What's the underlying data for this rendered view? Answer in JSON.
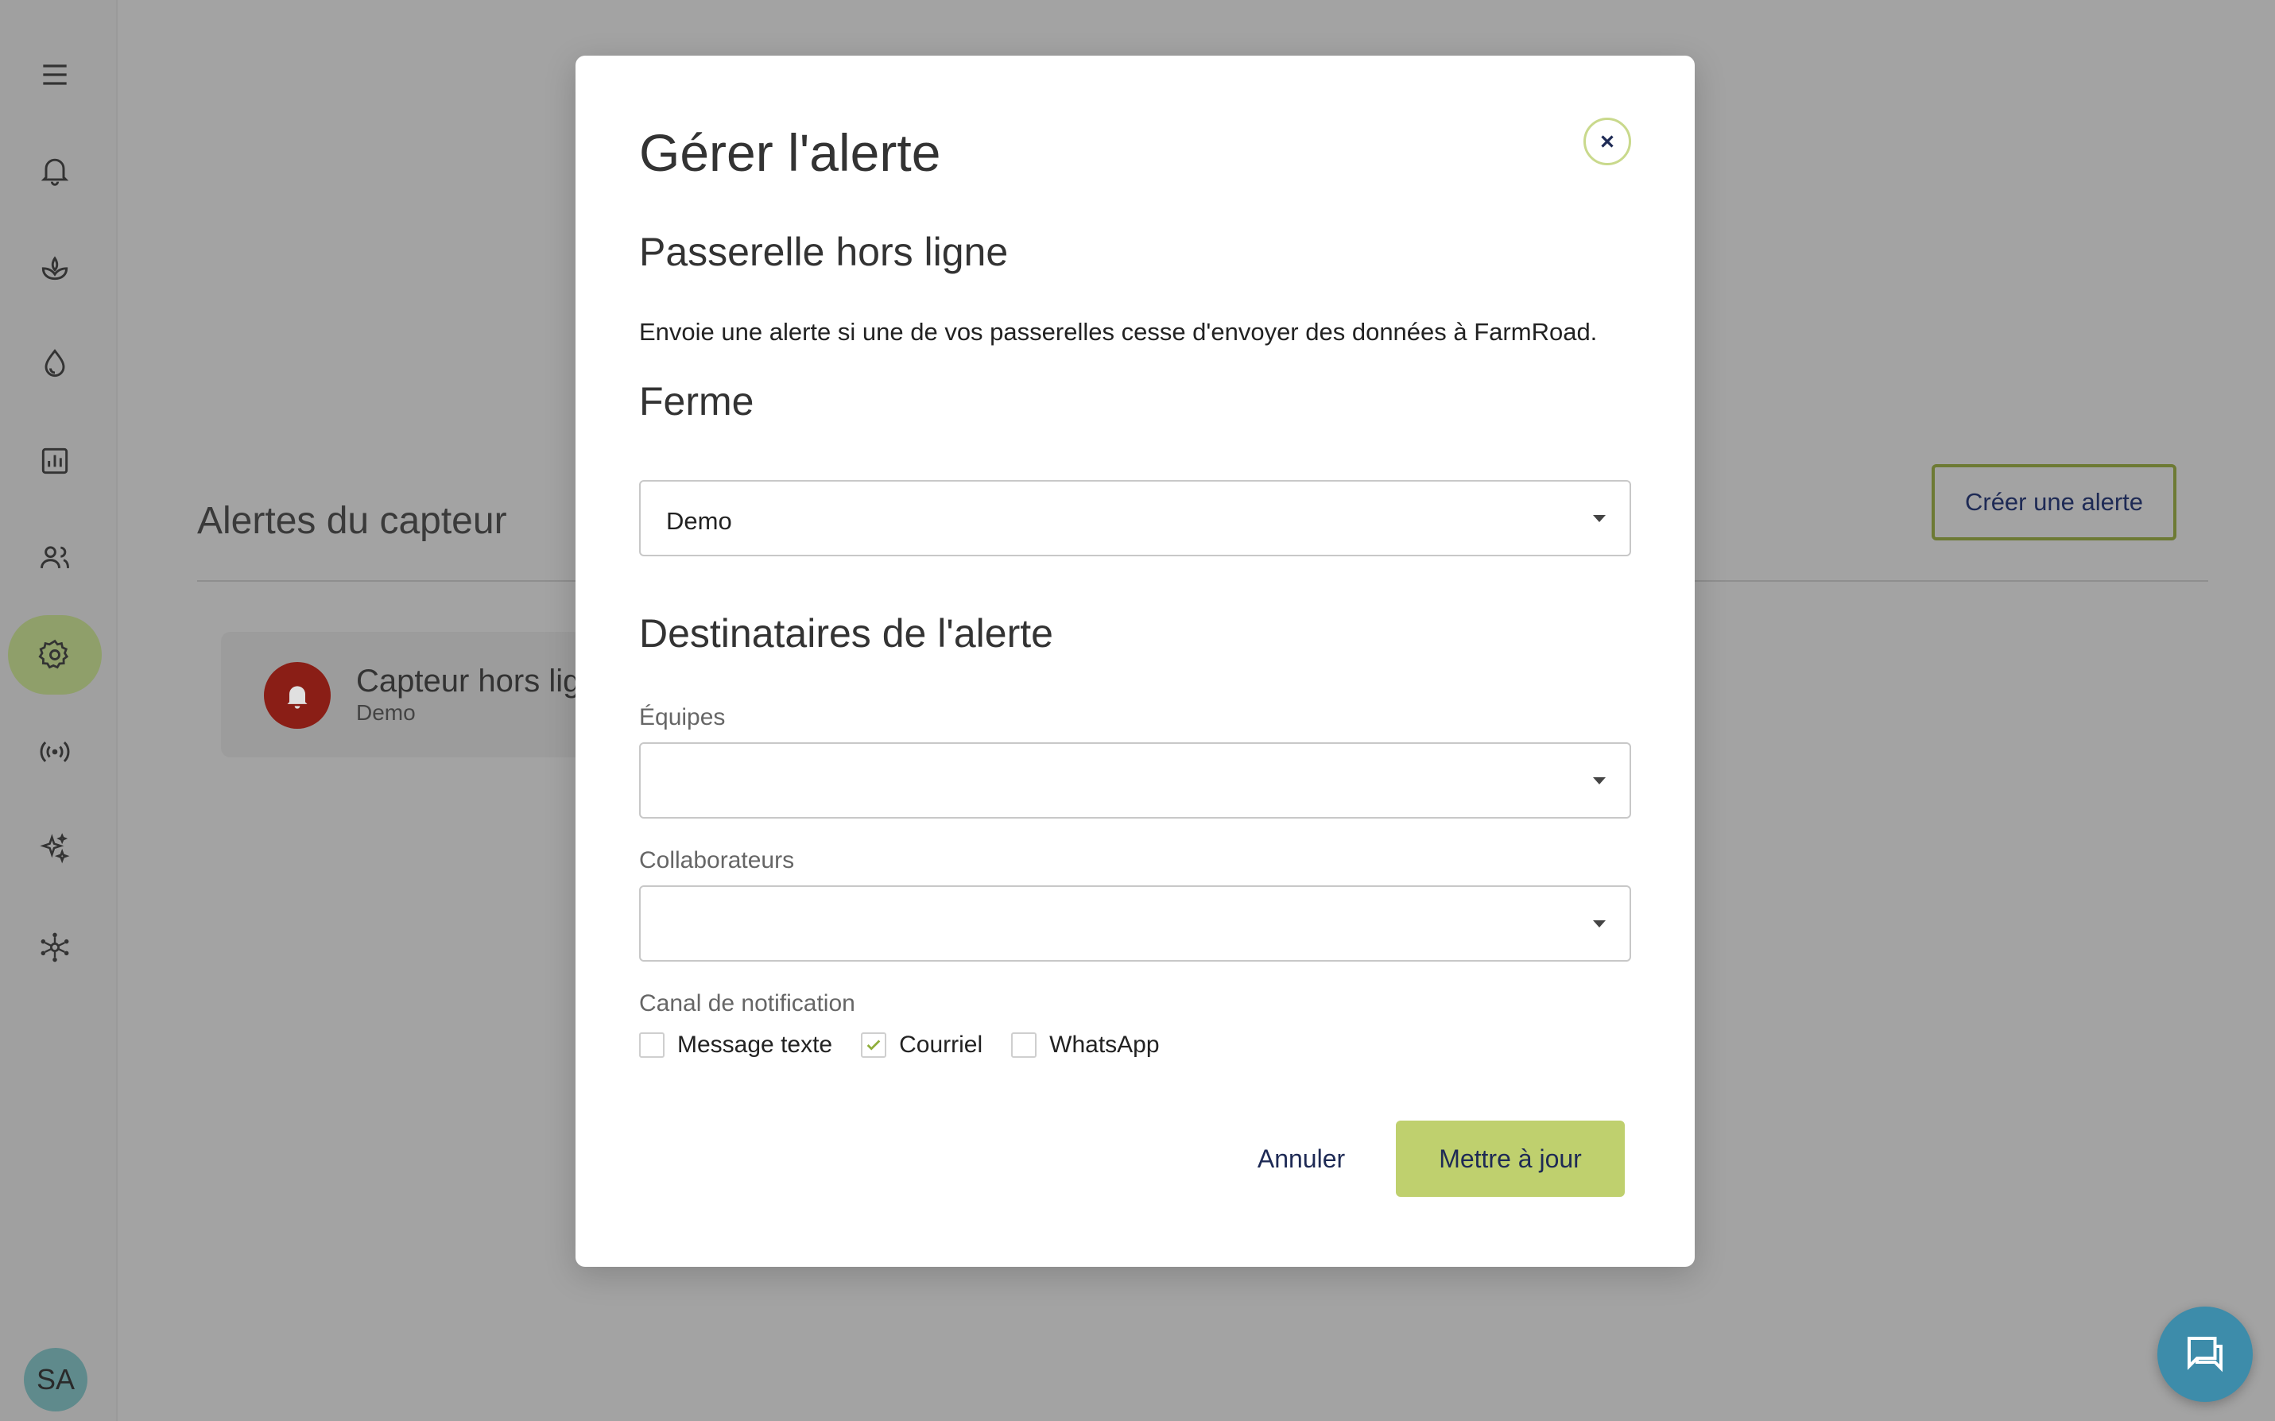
{
  "sidebar": {
    "items": [
      {
        "icon": "menu-icon"
      },
      {
        "icon": "bell-icon"
      },
      {
        "icon": "sprout-icon"
      },
      {
        "icon": "water-drop-icon"
      },
      {
        "icon": "bar-chart-icon"
      },
      {
        "icon": "people-icon"
      },
      {
        "icon": "gear-icon",
        "active": true
      },
      {
        "icon": "broadcast-icon"
      },
      {
        "icon": "sparkles-icon"
      },
      {
        "icon": "network-icon"
      }
    ],
    "avatar_initials": "SA"
  },
  "page": {
    "title": "Alertes du capteur",
    "create_button": "Créer une alerte",
    "alert_card": {
      "title": "Capteur hors ligne",
      "subtitle": "Demo"
    }
  },
  "modal": {
    "title": "Gérer l'alerte",
    "alert_type": "Passerelle hors ligne",
    "description": "Envoie une alerte si une de vos passerelles cesse d'envoyer des données à FarmRoad.",
    "farm_heading": "Ferme",
    "farm_value": "Demo",
    "recipients_heading": "Destinataires de l'alerte",
    "teams_label": "Équipes",
    "teams_value": "",
    "collaborators_label": "Collaborateurs",
    "collaborators_value": "",
    "channel_label": "Canal de notification",
    "channels": [
      {
        "label": "Message texte",
        "checked": false
      },
      {
        "label": "Courriel",
        "checked": true
      },
      {
        "label": "WhatsApp",
        "checked": false
      }
    ],
    "cancel_label": "Annuler",
    "update_label": "Mettre à jour"
  },
  "colors": {
    "accent": "#bfd06e",
    "active_nav": "#8f9f6a",
    "danger": "#8a1e16",
    "chat": "#3d8caa"
  }
}
